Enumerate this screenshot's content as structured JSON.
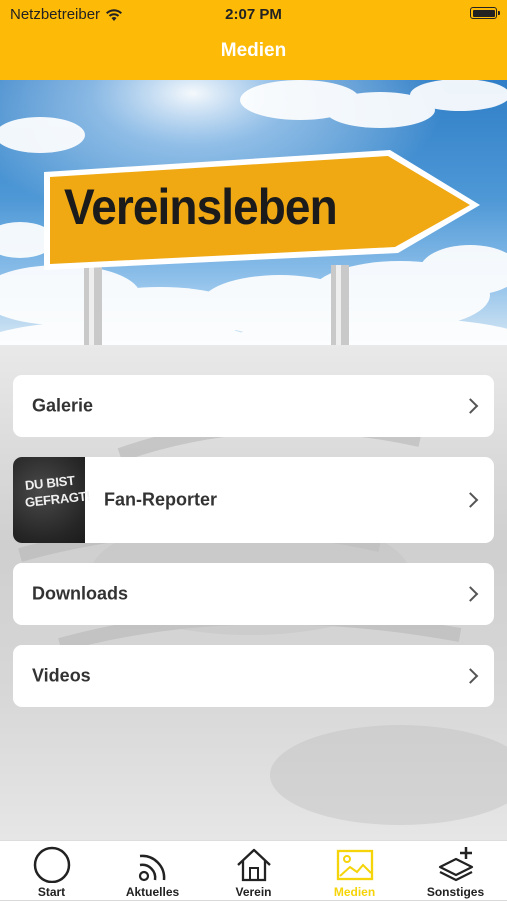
{
  "status_bar": {
    "carrier": "Netzbetreiber",
    "time": "2:07 PM"
  },
  "header": {
    "title": "Medien"
  },
  "hero": {
    "sign_text": "Vereinsleben"
  },
  "menu": {
    "items": [
      {
        "label": "Galerie"
      },
      {
        "label": "Fan-Reporter",
        "thumb_line1": "DU BIST",
        "thumb_line2": "GEFRAGT!"
      },
      {
        "label": "Downloads"
      },
      {
        "label": "Videos"
      }
    ]
  },
  "tabbar": {
    "tabs": [
      {
        "label": "Start",
        "icon": "circle-icon"
      },
      {
        "label": "Aktuelles",
        "icon": "rss-feed-icon"
      },
      {
        "label": "Verein",
        "icon": "home-icon"
      },
      {
        "label": "Medien",
        "icon": "image-icon",
        "active": true
      },
      {
        "label": "Sonstiges",
        "icon": "layers-plus-icon"
      }
    ],
    "active_color": "#f5d40a"
  },
  "colors": {
    "accent": "#fdbb08",
    "header_text": "#ffffff"
  }
}
